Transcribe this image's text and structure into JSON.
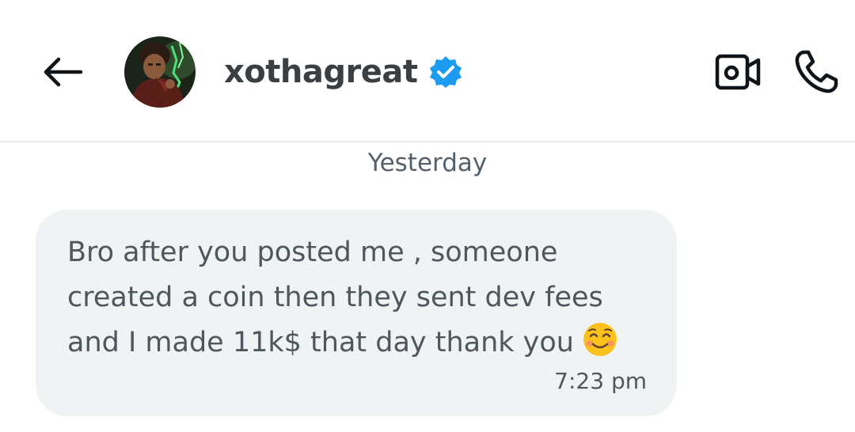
{
  "header": {
    "username": "xothagreat",
    "icons": {
      "back": "arrow-left-icon",
      "verified": "verified-badge-icon",
      "video": "video-call-icon",
      "call": "phone-icon"
    }
  },
  "conversation": {
    "date_separator": "Yesterday",
    "messages": [
      {
        "text": "Bro after you posted me , someone created a coin then they sent dev fees and I made 11k$ that day thank you",
        "emoji": "smiling-face-icon",
        "time": "7:23 pm"
      }
    ]
  },
  "colors": {
    "verified_blue": "#1d9bf0",
    "bubble_bg": "#eff3f4",
    "divider": "#e6e8ea",
    "muted_text": "#56606a"
  }
}
